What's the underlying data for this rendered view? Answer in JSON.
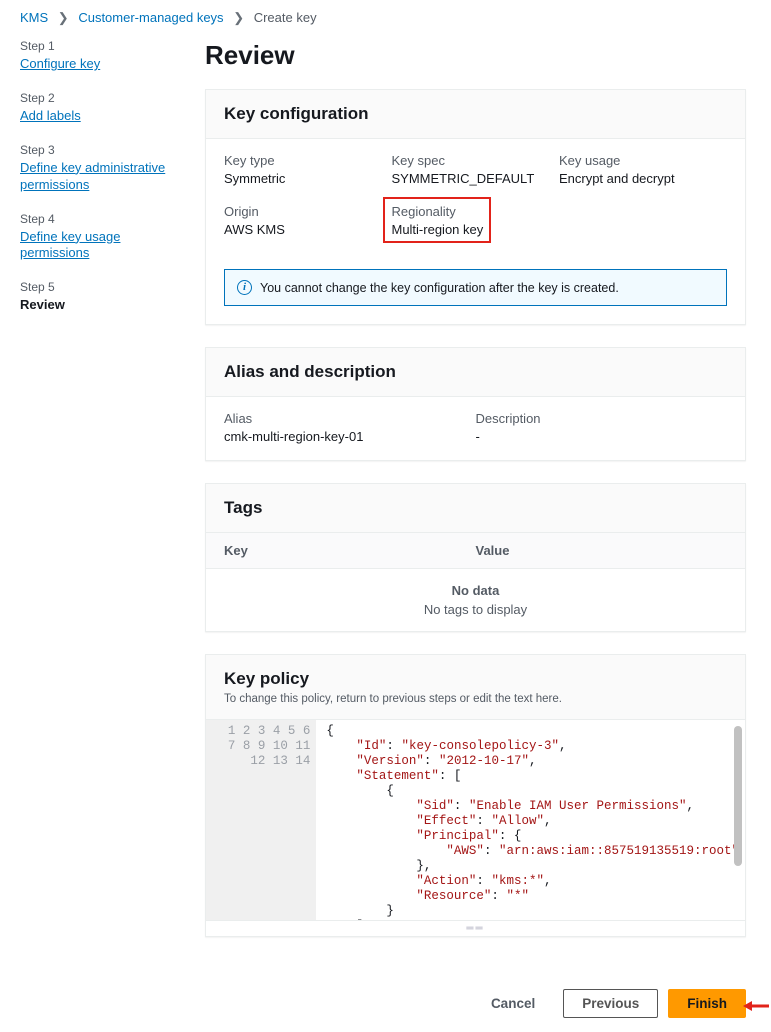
{
  "breadcrumbs": {
    "root": "KMS",
    "parent": "Customer-managed keys",
    "current": "Create key"
  },
  "sidebar": {
    "steps": [
      {
        "num": "Step 1",
        "label": "Configure key"
      },
      {
        "num": "Step 2",
        "label": "Add labels"
      },
      {
        "num": "Step 3",
        "label": "Define key administrative permissions"
      },
      {
        "num": "Step 4",
        "label": "Define key usage permissions"
      },
      {
        "num": "Step 5",
        "label": "Review"
      }
    ]
  },
  "page_title": "Review",
  "key_config": {
    "heading": "Key configuration",
    "key_type_label": "Key type",
    "key_type_value": "Symmetric",
    "key_spec_label": "Key spec",
    "key_spec_value": "SYMMETRIC_DEFAULT",
    "key_usage_label": "Key usage",
    "key_usage_value": "Encrypt and decrypt",
    "origin_label": "Origin",
    "origin_value": "AWS KMS",
    "regionality_label": "Regionality",
    "regionality_value": "Multi-region key",
    "info_text": "You cannot change the key configuration after the key is created."
  },
  "alias_desc": {
    "heading": "Alias and description",
    "alias_label": "Alias",
    "alias_value": "cmk-multi-region-key-01",
    "desc_label": "Description",
    "desc_value": "-"
  },
  "tags": {
    "heading": "Tags",
    "col_key": "Key",
    "col_value": "Value",
    "no_data": "No data",
    "no_tags": "No tags to display"
  },
  "key_policy": {
    "heading": "Key policy",
    "subtext": "To change this policy, return to previous steps or edit the text here.",
    "lines": [
      "{",
      "    \"Id\": \"key-consolepolicy-3\",",
      "    \"Version\": \"2012-10-17\",",
      "    \"Statement\": [",
      "        {",
      "            \"Sid\": \"Enable IAM User Permissions\",",
      "            \"Effect\": \"Allow\",",
      "            \"Principal\": {",
      "                \"AWS\": \"arn:aws:iam::857519135519:root\"",
      "            },",
      "            \"Action\": \"kms:*\",",
      "            \"Resource\": \"*\"",
      "        }",
      "    ]"
    ]
  },
  "footer": {
    "cancel": "Cancel",
    "previous": "Previous",
    "finish": "Finish"
  }
}
